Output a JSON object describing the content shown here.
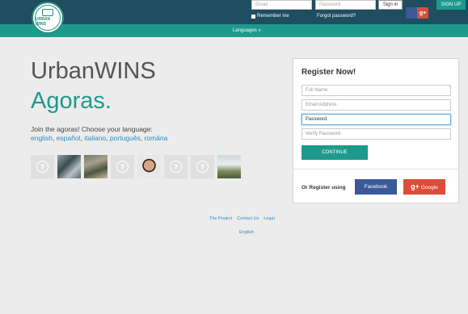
{
  "header": {
    "logo_text": "URBAN WINS",
    "email_placeholder": "Email",
    "password_placeholder": "Password",
    "signin_label": "Sign in",
    "remember_label": "Remember me",
    "forgot_label": "Forgot password?",
    "gplus_label": "g+",
    "signup_label": "SIGN UP",
    "languages_label": "Languages »"
  },
  "hero": {
    "title": "UrbanWINS",
    "subtitle": "Agoras.",
    "join_text": "Join the agoras! Choose your language:",
    "languages": [
      "english",
      "español",
      "italiano",
      "português",
      "româna"
    ],
    "language_separator": ",",
    "avatar_placeholder_glyph": "?"
  },
  "register": {
    "title": "Register Now!",
    "full_name_placeholder": "Full Name",
    "email_placeholder": "Email Address",
    "password_placeholder": "Password",
    "verify_placeholder": "Verify Password",
    "continue_label": "CONTINUE",
    "or_register": "Or Register using",
    "facebook_label": "Facebook",
    "google_label": "Google",
    "google_glyph": "g+"
  },
  "footer": {
    "links": [
      "The Project",
      "Contact Us",
      "Legal"
    ],
    "language": "English"
  },
  "colors": {
    "header_dark": "#1e4e5f",
    "accent_teal": "#1e9a8c",
    "link_blue": "#2b8fc0",
    "facebook_blue": "#3b5998",
    "google_red": "#dd4b39"
  }
}
